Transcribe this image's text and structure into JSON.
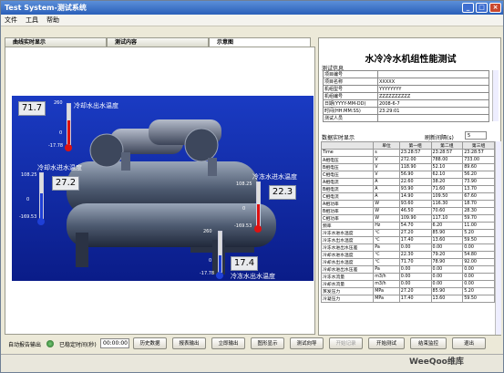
{
  "window": {
    "title": "Test System-测试系统",
    "min": "_",
    "max": "□",
    "close": "×"
  },
  "menu": [
    "文件",
    "工具",
    "帮助"
  ],
  "tabs": [
    "曲线实时显示",
    "测试内容",
    "示意图"
  ],
  "schematic": {
    "top_left": {
      "value": "71.7",
      "label": "冷却水出水温度",
      "scale_top": "260",
      "scale_zero": "0",
      "scale_bottom": "-17.78"
    },
    "mid_left": {
      "value": "27.2",
      "label": "冷却水进水温度",
      "scale_top": "108.25",
      "scale_zero": "0",
      "scale_bottom": "-169.53"
    },
    "right": {
      "value": "22.3",
      "label": "冷冻水进水温度",
      "scale_top": "108.25",
      "scale_zero": "0",
      "scale_bottom": "-169.53"
    },
    "bottom": {
      "value": "17.4",
      "label": "冷冻水出水温度",
      "scale_top": "260",
      "scale_zero": "0",
      "scale_bottom": "-17.78"
    }
  },
  "right_panel": {
    "title": "水冷冷水机组性能测试",
    "info_header": "测试信息",
    "info": [
      [
        "项目编号",
        ""
      ],
      [
        "项目名称",
        "XXXXX"
      ],
      [
        "机组型号",
        "YYYYYYYY"
      ],
      [
        "机组编号",
        "ZZZZZZZZZZ"
      ],
      [
        "日期(YYYY-MM-DD)",
        "2008-6-7"
      ],
      [
        "时间(HH:MM:SS)",
        "23:29:01"
      ],
      [
        "测试人员",
        ""
      ]
    ],
    "data_header": "数据实时显示",
    "refresh_label": "刷新间隔(s)",
    "refresh_value": "5",
    "columns": [
      "",
      "单位",
      "第一组",
      "第二组",
      "第三组"
    ],
    "rows": [
      [
        "Time",
        "s",
        "23:28:57",
        "23:28:57",
        "23:28:57"
      ],
      [
        "A相电压",
        "V",
        "272.00",
        "788.00",
        "733.00"
      ],
      [
        "B相电压",
        "V",
        "118.90",
        "52.10",
        "89.60"
      ],
      [
        "C相电压",
        "V",
        "56.90",
        "62.10",
        "56.20"
      ],
      [
        "A相电流",
        "A",
        "22.60",
        "38.20",
        "73.90"
      ],
      [
        "B相电流",
        "A",
        "93.90",
        "71.60",
        "13.70"
      ],
      [
        "C相电流",
        "A",
        "14.90",
        "109.50",
        "67.60"
      ],
      [
        "A相功率",
        "W",
        "93.60",
        "116.30",
        "18.70"
      ],
      [
        "B相功率",
        "W",
        "46.50",
        "70.60",
        "28.30"
      ],
      [
        "C相功率",
        "W",
        "109.90",
        "117.10",
        "59.70"
      ],
      [
        "频率",
        "Hz",
        "54.70",
        "6.20",
        "11.00"
      ],
      [
        "冷冻水进水温度",
        "℃",
        "27.20",
        "85.90",
        "5.20"
      ],
      [
        "冷冻水出水温度",
        "℃",
        "17.40",
        "13.60",
        "59.50"
      ],
      [
        "冷冻水进出水压差",
        "Pa",
        "0.00",
        "0.00",
        "0.00"
      ],
      [
        "冷却水进水温度",
        "℃",
        "22.30",
        "79.20",
        "54.80"
      ],
      [
        "冷却水出水温度",
        "℃",
        "71.70",
        "78.90",
        "92.00"
      ],
      [
        "冷却水进出水压差",
        "Pa",
        "0.00",
        "0.00",
        "0.00"
      ],
      [
        "冷冻水流量",
        "m3/h",
        "0.00",
        "0.00",
        "0.00"
      ],
      [
        "冷却水流量",
        "m3/h",
        "0.00",
        "0.00",
        "0.00"
      ],
      [
        "蒸发压力",
        "MPa",
        "27.20",
        "85.90",
        "5.20"
      ],
      [
        "冷凝压力",
        "MPa",
        "17.40",
        "13.60",
        "59.50"
      ]
    ]
  },
  "bottom": {
    "auto_report": "自动报告输出",
    "stable_time_label": "已稳定时间(秒)",
    "stable_time": "00:00:00",
    "buttons": [
      "历史数据",
      "报表输出",
      "立即输出",
      "图形显示",
      "测试向导",
      "开始记录",
      "开始测试",
      "结束监控",
      "退出"
    ]
  },
  "watermark": "WeeQoo维库"
}
